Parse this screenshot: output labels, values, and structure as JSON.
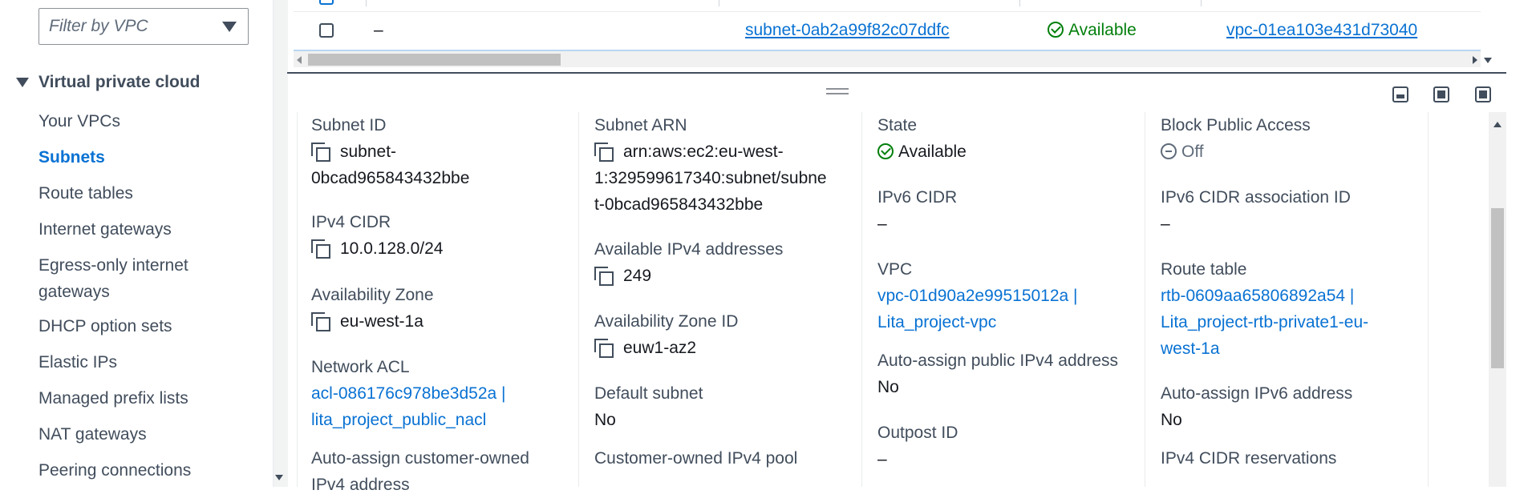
{
  "sidebar": {
    "filter_placeholder": "Filter by VPC",
    "section_title": "Virtual private cloud",
    "items": [
      {
        "label": "Your VPCs"
      },
      {
        "label": "Subnets"
      },
      {
        "label": "Route tables"
      },
      {
        "label": "Internet gateways"
      },
      {
        "label": "Egress-only internet gateways"
      },
      {
        "label": "DHCP option sets"
      },
      {
        "label": "Elastic IPs"
      },
      {
        "label": "Managed prefix lists"
      },
      {
        "label": "NAT gateways"
      },
      {
        "label": "Peering connections"
      }
    ]
  },
  "table": {
    "row": {
      "name": "–",
      "subnet_id": "subnet-0ab2a99f82c07ddfc",
      "state": "Available",
      "vpc": "vpc-01ea103e431d73040"
    }
  },
  "details": {
    "subnet_id_label": "Subnet ID",
    "subnet_id_line1": "subnet-",
    "subnet_id_line2": "0bcad965843432bbe",
    "ipv4_cidr_label": "IPv4 CIDR",
    "ipv4_cidr": "10.0.128.0/24",
    "az_label": "Availability Zone",
    "az": "eu-west-1a",
    "nacl_label": "Network ACL",
    "nacl_line1": "acl-086176c978be3d52a |",
    "nacl_line2": "lita_project_public_nacl",
    "auto_assign_coip_label": "Auto-assign customer-owned",
    "auto_assign_coip_label2": "IPv4 address",
    "subnet_arn_label": "Subnet ARN",
    "subnet_arn_line1": "arn:aws:ec2:eu-west-",
    "subnet_arn_line2": "1:329599617340:subnet/subne",
    "subnet_arn_line3": "t-0bcad965843432bbe",
    "avail_ipv4_label": "Available IPv4 addresses",
    "avail_ipv4": "249",
    "az_id_label": "Availability Zone ID",
    "az_id": "euw1-az2",
    "default_subnet_label": "Default subnet",
    "default_subnet": "No",
    "coip_pool_label": "Customer-owned IPv4 pool",
    "state_label": "State",
    "state": "Available",
    "ipv6_cidr_label": "IPv6 CIDR",
    "ipv6_cidr": "–",
    "vpc_label": "VPC",
    "vpc_line1": "vpc-01d90a2e99515012a |",
    "vpc_line2": "Lita_project-vpc",
    "auto_assign_public_label": "Auto-assign public IPv4 address",
    "auto_assign_public": "No",
    "outpost_label": "Outpost ID",
    "outpost": "–",
    "bpa_label": "Block Public Access",
    "bpa": "Off",
    "ipv6_assoc_label": "IPv6 CIDR association ID",
    "ipv6_assoc": "–",
    "route_table_label": "Route table",
    "route_table_line1": "rtb-0609aa65806892a54 |",
    "route_table_line2": "Lita_project-rtb-private1-eu-",
    "route_table_line3": "west-1a",
    "auto_assign_ipv6_label": "Auto-assign IPv6 address",
    "auto_assign_ipv6": "No",
    "ipv4_reservations_label": "IPv4 CIDR reservations"
  },
  "colors": {
    "link": "#0972d3",
    "success": "#037f0c",
    "text": "#16191f",
    "label": "#414d5c"
  }
}
